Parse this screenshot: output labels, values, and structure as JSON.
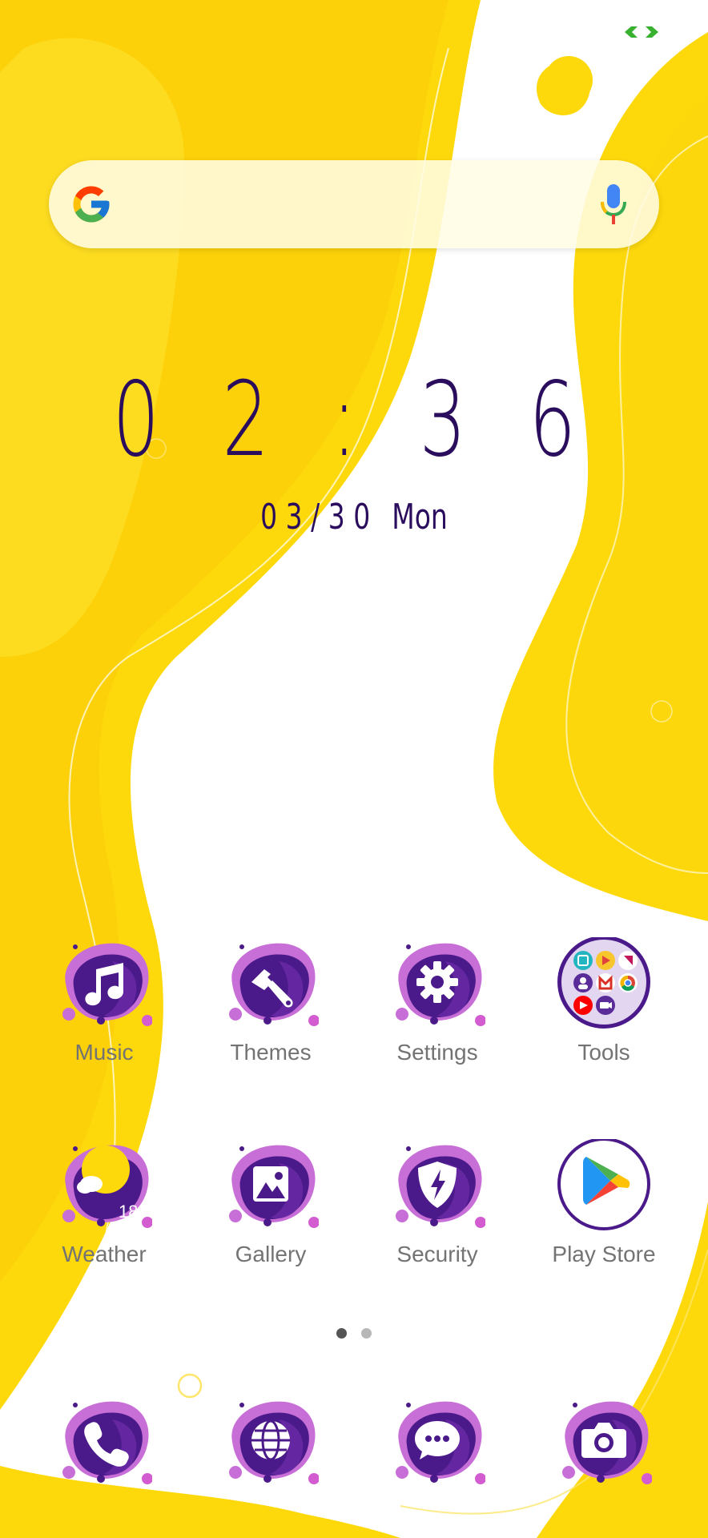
{
  "status_bar": {
    "icon": "link-icon",
    "color": "#38b12f"
  },
  "search": {
    "logo": "google-g-icon",
    "mic": "mic-icon"
  },
  "clock": {
    "time": "0 2 : 3 6",
    "date": "0 3 / 3 0",
    "day": "Mon"
  },
  "apps_row1": [
    {
      "label": "Music",
      "icon": "music-note-icon"
    },
    {
      "label": "Themes",
      "icon": "paintbrush-icon"
    },
    {
      "label": "Settings",
      "icon": "gear-icon"
    },
    {
      "label": "Tools",
      "icon": "folder-icon"
    }
  ],
  "apps_row2": [
    {
      "label": "Weather",
      "icon": "weather-icon",
      "temp": "18°"
    },
    {
      "label": "Gallery",
      "icon": "image-icon"
    },
    {
      "label": "Security",
      "icon": "shield-bolt-icon"
    },
    {
      "label": "Play Store",
      "icon": "play-store-icon"
    }
  ],
  "pages": {
    "count": 2,
    "active": 1
  },
  "dock": [
    {
      "icon": "phone-icon"
    },
    {
      "icon": "globe-icon"
    },
    {
      "icon": "chat-bubble-icon"
    },
    {
      "icon": "camera-icon"
    }
  ],
  "colors": {
    "yellow": "#fdd90c",
    "purple": "#4b1a8a",
    "accent": "#d35cd0"
  }
}
